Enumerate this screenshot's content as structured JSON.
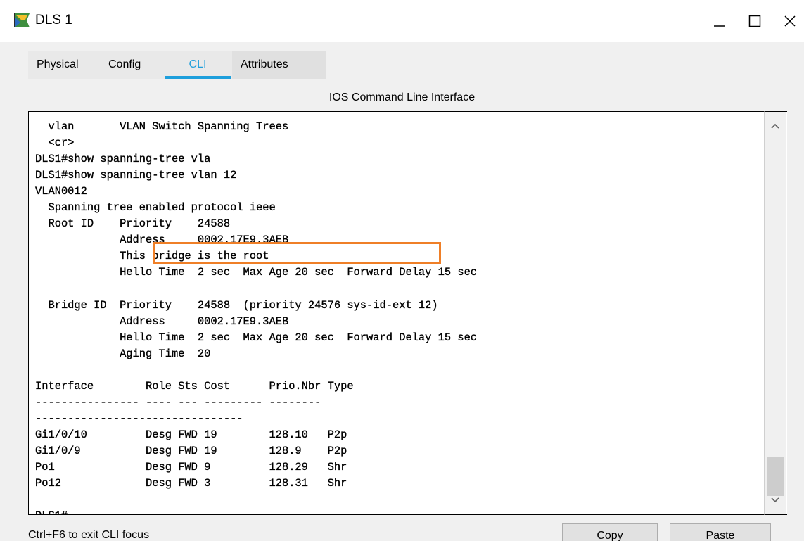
{
  "window": {
    "title": "DLS 1",
    "icon": "packet-tracer-switch-icon",
    "controls": {
      "minimize": "—",
      "maximize": "☐",
      "close": "✕"
    }
  },
  "tabs": [
    {
      "label": "Physical",
      "active": false
    },
    {
      "label": "Config",
      "active": false
    },
    {
      "label": "CLI",
      "active": true
    },
    {
      "label": "Attributes",
      "active": false
    }
  ],
  "panel": {
    "title": "IOS Command Line Interface"
  },
  "terminal": {
    "text": "  vlan       VLAN Switch Spanning Trees\n  <cr>\nDLS1#show spanning-tree vla\nDLS1#show spanning-tree vlan 12\nVLAN0012\n  Spanning tree enabled protocol ieee\n  Root ID    Priority    24588\n             Address     0002.17E9.3AEB\n             This bridge is the root\n             Hello Time  2 sec  Max Age 20 sec  Forward Delay 15 sec\n\n  Bridge ID  Priority    24588  (priority 24576 sys-id-ext 12)\n             Address     0002.17E9.3AEB\n             Hello Time  2 sec  Max Age 20 sec  Forward Delay 15 sec\n             Aging Time  20\n\nInterface        Role Sts Cost      Prio.Nbr Type\n---------------- ---- --- --------- --------\n--------------------------------\nGi1/0/10         Desg FWD 19        128.10   P2p\nGi1/0/9          Desg FWD 19        128.9    P2p\nPo1              Desg FWD 9         128.29   Shr\nPo12             Desg FWD 3         128.31   Shr\n\nDLS1#",
    "highlight_line": "This bridge is the root",
    "highlight_color": "#ef7f27"
  },
  "statusbar": {
    "hint": "Ctrl+F6 to exit CLI focus"
  },
  "buttons": {
    "copy": "Copy",
    "paste": "Paste"
  },
  "colors": {
    "accent": "#1e9fdc"
  }
}
